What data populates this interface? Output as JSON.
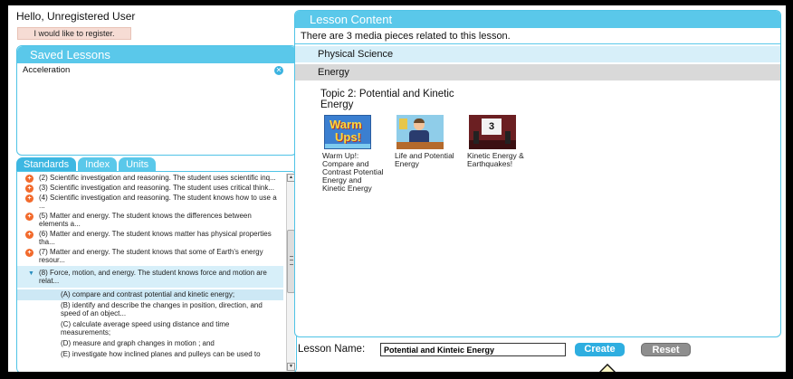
{
  "user": {
    "greeting": "Hello, Unregistered User",
    "register_label": "I would like to register."
  },
  "saved_lessons": {
    "title": "Saved Lessons",
    "items": [
      {
        "label": "Acceleration",
        "remove_icon": "close-circle-icon"
      }
    ]
  },
  "tabs": [
    {
      "label": "Standards",
      "active": true
    },
    {
      "label": "Index",
      "active": false
    },
    {
      "label": "Units",
      "active": false
    }
  ],
  "standards": [
    {
      "text": "(2) Scientific investigation and reasoning. The student uses scientific inq...",
      "icon": "plus-circle-icon"
    },
    {
      "text": "(3) Scientific investigation and reasoning. The student uses critical think...",
      "icon": "plus-circle-icon"
    },
    {
      "text": "(4) Scientific investigation and reasoning. The student knows how to use a ...",
      "icon": "plus-circle-icon"
    },
    {
      "text": "(5) Matter and energy. The student knows the differences between elements a...",
      "icon": "plus-circle-icon"
    },
    {
      "text": "(6) Matter and energy. The student knows matter has physical properties tha...",
      "icon": "plus-circle-icon"
    },
    {
      "text": "(7) Matter and energy. The student knows that some of Earth's energy resour...",
      "icon": "plus-circle-icon"
    }
  ],
  "expanded_standard": {
    "text": "(8) Force, motion, and energy. The student knows force and motion are relat...",
    "icon": "caret-down-icon",
    "children": [
      {
        "text": "(A) compare and contrast potential and kinetic energy;",
        "selected": true
      },
      {
        "text": "(B) identify and describe the changes in position, direction, and speed of an object...",
        "selected": false
      },
      {
        "text": "(C) calculate average speed using distance and time measurements;",
        "selected": false
      },
      {
        "text": "(D) measure and graph changes in motion ; and",
        "selected": false
      },
      {
        "text": "(E) investigate how inclined planes and pulleys can be used to",
        "selected": false
      }
    ]
  },
  "lesson_content": {
    "title": "Lesson Content",
    "media_count_text": "There are 3 media pieces related to this lesson.",
    "subject": "Physical Science",
    "category": "Energy",
    "topic": "Topic 2: Potential and Kinetic Energy",
    "media": [
      {
        "title": "Warm Up!: Compare and Contrast Potential Energy and Kinetic Energy",
        "thumb_text_1": "Warm",
        "thumb_text_2": "Ups!"
      },
      {
        "title": "Life and Potential Energy"
      },
      {
        "title": "Kinetic Energy & Earthquakes!",
        "thumb_text": "3"
      }
    ]
  },
  "lesson_name": {
    "label": "Lesson Name:",
    "value": "Potential and Kinteic Energy",
    "create_label": "Create",
    "reset_label": "Reset"
  },
  "colors": {
    "accent": "#5ac8ea",
    "bullet": "#f26a2c",
    "create": "#2eaee0",
    "reset": "#8e8e8e"
  }
}
